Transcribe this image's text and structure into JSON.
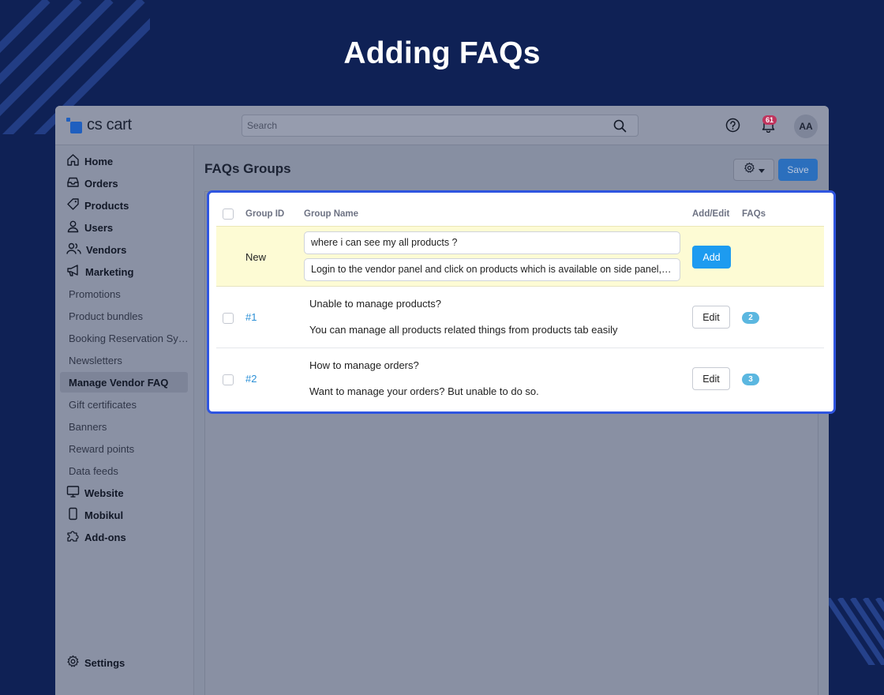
{
  "hero": {
    "title": "Adding FAQs"
  },
  "app": {
    "logo_text": "cs cart",
    "search_placeholder": "Search",
    "notifications_count": "61",
    "avatar_initials": "AA"
  },
  "sidebar": {
    "items": [
      {
        "label": "Home",
        "icon": "home-icon"
      },
      {
        "label": "Orders",
        "icon": "inbox-icon"
      },
      {
        "label": "Products",
        "icon": "tag-icon"
      },
      {
        "label": "Users",
        "icon": "user-icon"
      },
      {
        "label": "Vendors",
        "icon": "users-icon"
      },
      {
        "label": "Marketing",
        "icon": "megaphone-icon"
      }
    ],
    "marketing_sub": [
      "Promotions",
      "Product bundles",
      "Booking Reservation Sy…",
      "Newsletters",
      "Manage Vendor FAQ",
      "Gift certificates",
      "Banners",
      "Reward points",
      "Data feeds"
    ],
    "active_sub": "Manage Vendor FAQ",
    "bottom_items": [
      {
        "label": "Website",
        "icon": "monitor-icon"
      },
      {
        "label": "Mobikul",
        "icon": "phone-icon"
      },
      {
        "label": "Add-ons",
        "icon": "puzzle-icon"
      }
    ],
    "settings_label": "Settings"
  },
  "page": {
    "title": "FAQs Groups",
    "save_label": "Save"
  },
  "table": {
    "headers": {
      "group_id": "Group ID",
      "group_name": "Group Name",
      "add_edit": "Add/Edit",
      "faqs": "FAQs"
    },
    "new_row": {
      "label": "New",
      "question_value": "where i can see my all products ?",
      "answer_value": "Login to the vendor panel and click on products which is available on side panel, th…",
      "add_label": "Add"
    },
    "rows": [
      {
        "id": "#1",
        "question": "Unable to manage products?",
        "answer": "You can manage all products related things from products tab easily",
        "edit_label": "Edit",
        "faq_count": "2"
      },
      {
        "id": "#2",
        "question": "How to manage orders?",
        "answer": "Want to manage your orders? But unable to do so.",
        "edit_label": "Edit",
        "faq_count": "3"
      }
    ]
  },
  "colors": {
    "background": "#0f2155",
    "highlight_border": "#2f55e0",
    "primary_button": "#1d9bf0",
    "link": "#2a8fd6",
    "badge": "#5bb7e0",
    "new_row_bg": "#fdfbd4"
  }
}
